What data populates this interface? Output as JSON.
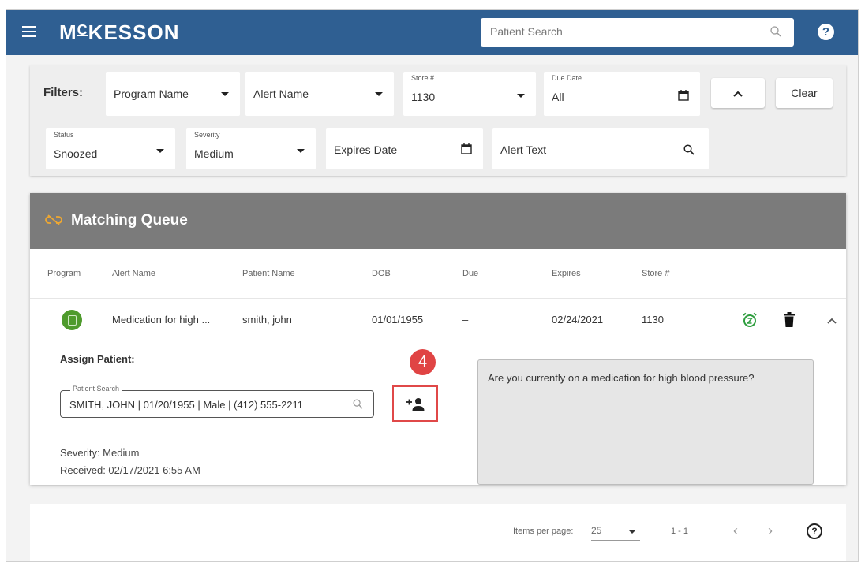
{
  "header": {
    "logo": "MCKESSON",
    "logo_parts": {
      "m": "M",
      "c": "C",
      "rest": "KESSON"
    },
    "search_placeholder": "Patient Search",
    "help_glyph": "?"
  },
  "filters": {
    "label": "Filters:",
    "program_name": {
      "value": "Program Name"
    },
    "alert_name": {
      "value": "Alert Name"
    },
    "store": {
      "label": "Store #",
      "value": "1130"
    },
    "due_date": {
      "label": "Due Date",
      "value": "All"
    },
    "collapse_glyph": "^",
    "clear_label": "Clear",
    "status": {
      "label": "Status",
      "value": "Snoozed"
    },
    "severity": {
      "label": "Severity",
      "value": "Medium"
    },
    "expires_date": {
      "value": "Expires Date"
    },
    "alert_text": {
      "value": "Alert Text"
    }
  },
  "queue": {
    "title": "Matching Queue",
    "title_icon": "link-off-icon",
    "columns": [
      "Program",
      "Alert Name",
      "Patient Name",
      "DOB",
      "Due",
      "Expires",
      "Store #"
    ],
    "row": {
      "program_icon": "program-icon",
      "alert_name": "Medication for high ...",
      "patient_name": "smith, john",
      "dob": "01/01/1955",
      "due": "–",
      "expires": "02/24/2021",
      "store": "1130"
    },
    "assign_label": "Assign Patient:",
    "patient_search": {
      "label": "Patient Search",
      "value": "SMITH, JOHN | 01/20/1955 | Male | (412) 555-2211"
    },
    "step_badge": "4",
    "severity_text": "Severity: Medium",
    "received_text": "Received: 02/17/2021 6:55 AM",
    "alert_question": "Are you currently on a medication for high blood pressure?"
  },
  "footer": {
    "items_per_page_label": "Items per page:",
    "items_per_page_value": "25",
    "range": "1 - 1",
    "prev_glyph": "‹",
    "next_glyph": "›",
    "help_glyph": "?"
  },
  "colors": {
    "header_bg": "#2f5f92",
    "queue_header_bg": "#7b7b7b",
    "snooze_green": "#2e9e3e",
    "highlight_red": "#e04848",
    "link_icon_orange": "#f0a830"
  }
}
